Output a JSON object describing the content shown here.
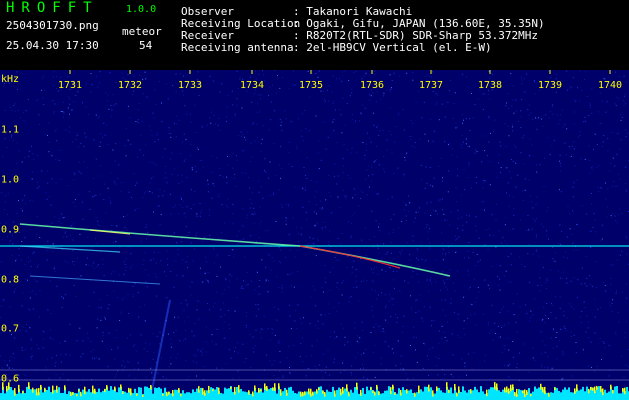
{
  "app": {
    "logo": "HROFFT",
    "version": "1.0.0"
  },
  "file": {
    "name": "2504301730.png",
    "datetime": "25.04.30 17:30",
    "mode_label": "meteor",
    "count": "54"
  },
  "station": {
    "observer_label": "Observer",
    "observer_value": ": Takanori Kawachi",
    "location_label": "Receiving Location",
    "location_value": ": Ogaki, Gifu, JAPAN (136.60E, 35.35N)",
    "receiver_label": "Receiver",
    "receiver_value": ": R820T2(RTL-SDR) SDR-Sharp 53.372MHz",
    "antenna_label": "Receiving antenna",
    "antenna_value": ": 2el-HB9CV Vertical (el. E-W)"
  },
  "axes": {
    "y_unit": "kHz",
    "x_ticks": [
      "1731",
      "1732",
      "1733",
      "1734",
      "1735",
      "1736",
      "1737",
      "1738",
      "1739",
      "1740"
    ],
    "y_ticks": [
      "1.1",
      "1.0",
      "0.9",
      "0.8",
      "0.7",
      "0.6"
    ]
  },
  "colors": {
    "background": "#000000",
    "label": "#ffff00",
    "logo": "#00ff00",
    "noise_floor": "#00008b",
    "signal_line": "#00ffff",
    "meteor_hot": "#ff3030",
    "bottom_bar": "#00e5ff",
    "bottom_spikes": "#ffff00"
  }
}
